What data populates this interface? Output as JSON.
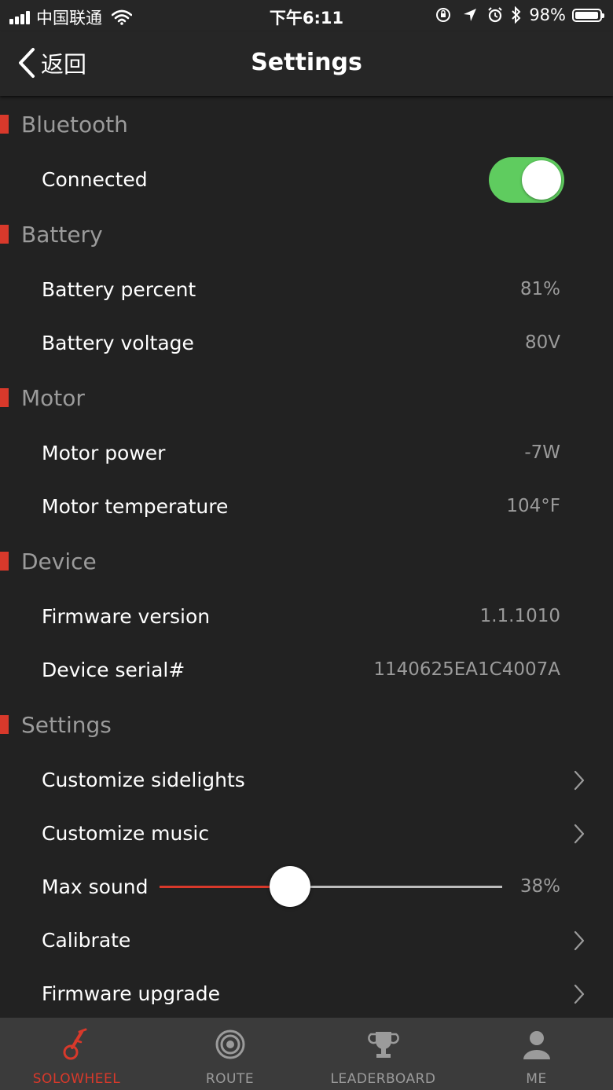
{
  "status_bar": {
    "carrier": "中国联通",
    "time": "下午6:11",
    "battery_percent": "98%"
  },
  "nav": {
    "back_label": "返回",
    "title": "Settings"
  },
  "sections": {
    "bluetooth": {
      "title": "Bluetooth",
      "connected_label": "Connected",
      "connected": true
    },
    "battery": {
      "title": "Battery",
      "percent_label": "Battery percent",
      "percent_value": "81%",
      "voltage_label": "Battery voltage",
      "voltage_value": "80V"
    },
    "motor": {
      "title": "Motor",
      "power_label": "Motor power",
      "power_value": "-7W",
      "temperature_label": "Motor temperature",
      "temperature_value": "104°F"
    },
    "device": {
      "title": "Device",
      "firmware_label": "Firmware version",
      "firmware_value": "1.1.1010",
      "serial_label": "Device serial#",
      "serial_value": "1140625EA1C4007A"
    },
    "settings": {
      "title": "Settings",
      "sidelights_label": "Customize sidelights",
      "music_label": "Customize music",
      "max_sound_label": "Max sound",
      "max_sound_value": "38%",
      "max_sound_fraction": 0.38,
      "calibrate_label": "Calibrate",
      "firmware_upgrade_label": "Firmware upgrade"
    }
  },
  "tabs": [
    {
      "label": "SOLOWHEEL",
      "icon": "unicycle-icon",
      "active": true
    },
    {
      "label": "ROUTE",
      "icon": "target-icon",
      "active": false
    },
    {
      "label": "LEADERBOARD",
      "icon": "trophy-icon",
      "active": false
    },
    {
      "label": "ME",
      "icon": "person-icon",
      "active": false
    }
  ],
  "colors": {
    "accent": "#d8392b",
    "toggle_on": "#5fcc5f",
    "background": "#222222",
    "secondary_text": "#9b9b9b"
  }
}
